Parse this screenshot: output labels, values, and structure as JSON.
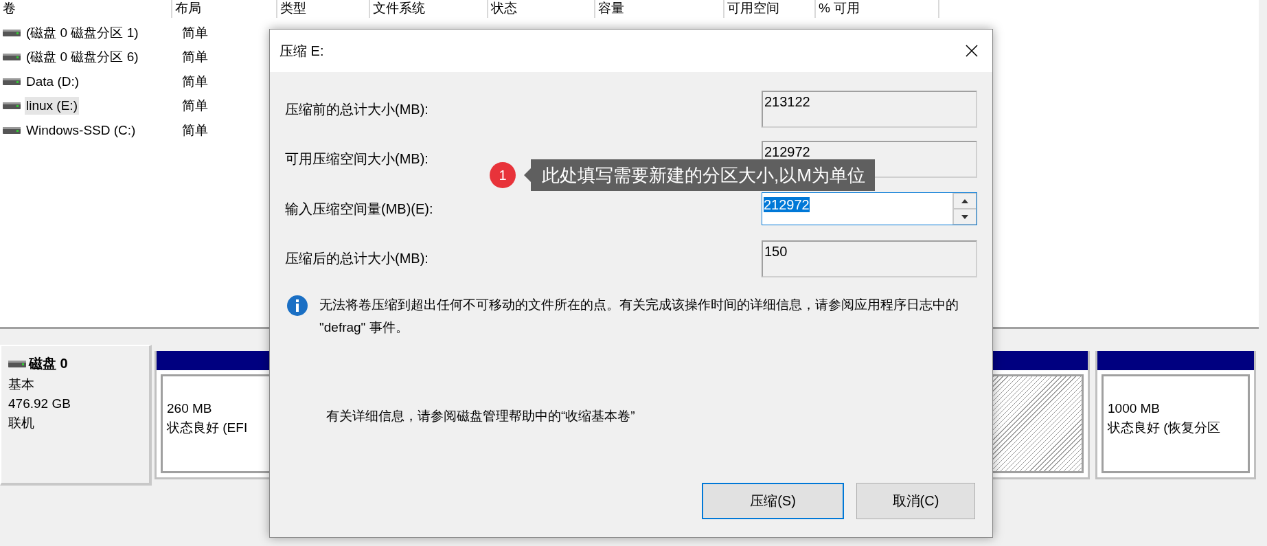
{
  "volume_table": {
    "columns": [
      "卷",
      "布局",
      "类型",
      "文件系统",
      "状态",
      "容量",
      "可用空间",
      "% 可用"
    ],
    "rows": [
      {
        "volume": "(磁盘 0 磁盘分区 1)",
        "layout": "简单",
        "selected": false
      },
      {
        "volume": "(磁盘 0 磁盘分区 6)",
        "layout": "简单",
        "selected": false
      },
      {
        "volume": "Data (D:)",
        "layout": "简单",
        "selected": false
      },
      {
        "volume": "linux (E:)",
        "layout": "简单",
        "selected": true
      },
      {
        "volume": "Windows-SSD (C:)",
        "layout": "简单",
        "selected": false
      }
    ]
  },
  "disk": {
    "name": "磁盘 0",
    "type": "基本",
    "size": "476.92 GB",
    "status": "联机",
    "partitions": [
      {
        "size": "260 MB",
        "status": "状态良好 (EFI",
        "selected": false
      },
      {
        "selected": true
      },
      {
        "size": "1000 MB",
        "status": "状态良好 (恢复分区",
        "selected": false
      }
    ]
  },
  "dialog": {
    "title": "压缩 E:",
    "fields": [
      {
        "kind": "readonly",
        "label": "压缩前的总计大小(MB):",
        "value": "213122"
      },
      {
        "kind": "readonly",
        "label": "可用压缩空间大小(MB):",
        "value": "212972"
      },
      {
        "kind": "spin",
        "label": "输入压缩空间量(MB)(E):",
        "value": "212972"
      },
      {
        "kind": "readonly",
        "label": "压缩后的总计大小(MB):",
        "value": "150"
      }
    ],
    "info": "无法将卷压缩到超出任何不可移动的文件所在的点。有关完成该操作时间的详细信息，请参阅应用程序日志中的 \"defrag\" 事件。",
    "help": "有关详细信息，请参阅磁盘管理帮助中的“收缩基本卷”",
    "buttons": [
      {
        "label": "压缩(S)",
        "default": true
      },
      {
        "label": "取消(C)",
        "default": false
      }
    ]
  },
  "annotation": {
    "badge": "1",
    "text": "此处填写需要新建的分区大小,以M为单位"
  }
}
